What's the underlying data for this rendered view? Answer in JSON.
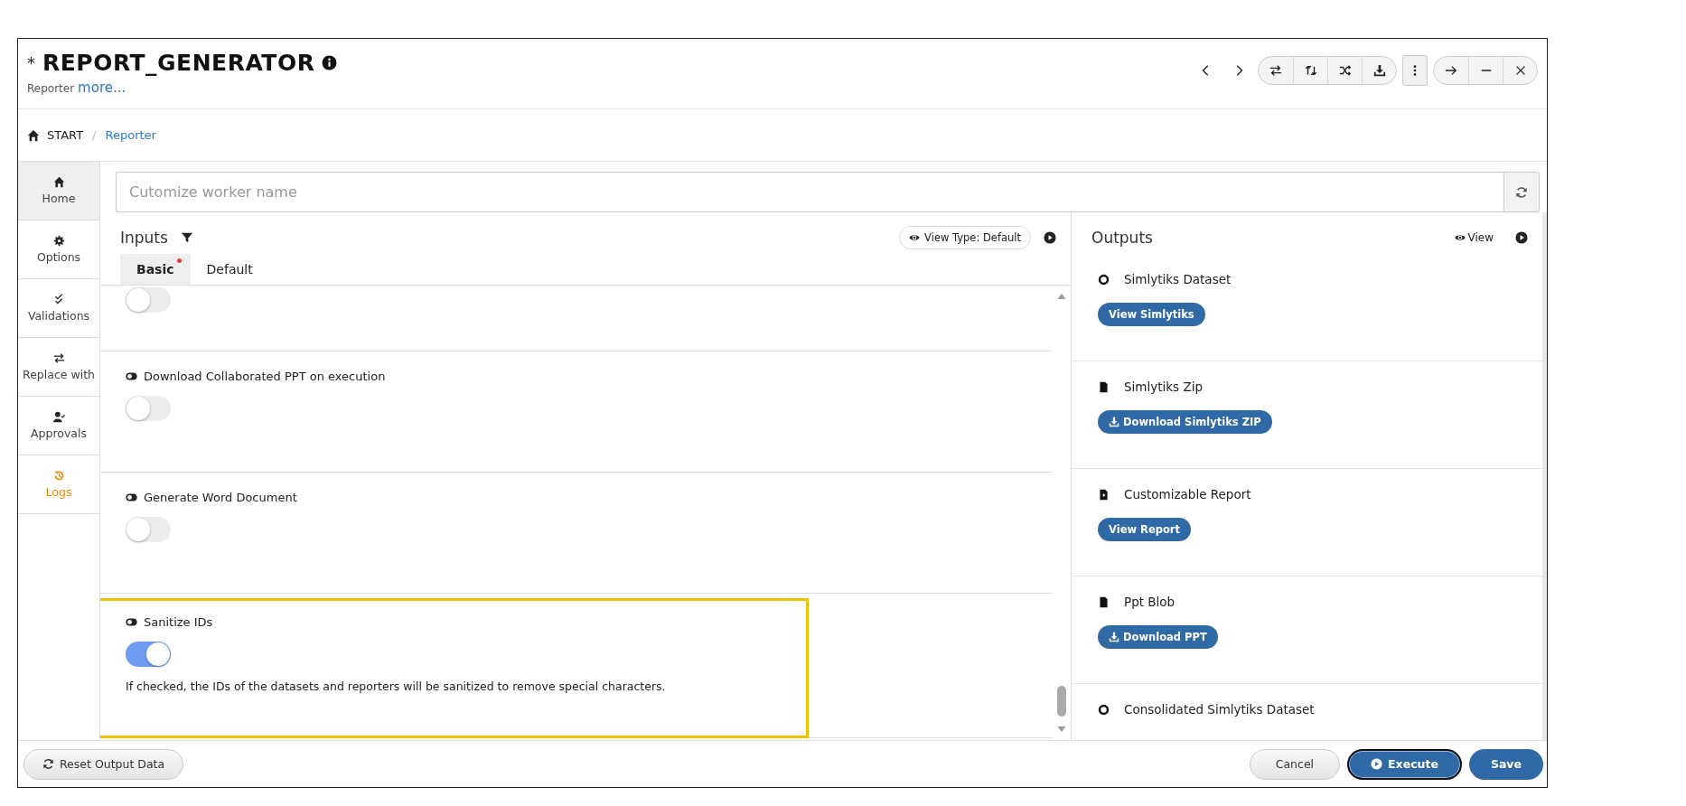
{
  "window": {
    "modified_mark": "*",
    "title": "REPORT_GENERATOR",
    "subtitle": "Reporter",
    "more_link": "more..."
  },
  "breadcrumb": [
    {
      "label": "START",
      "kind": "home"
    },
    {
      "label": "Reporter",
      "kind": "link"
    }
  ],
  "breadcrumb_separator": "/",
  "sidebar": {
    "items": [
      {
        "label": "Home",
        "selected": true,
        "attention": false
      },
      {
        "label": "Options",
        "selected": false,
        "attention": false
      },
      {
        "label": "Validations",
        "selected": false,
        "attention": false
      },
      {
        "label": "Replace with",
        "selected": false,
        "attention": false
      },
      {
        "label": "Approvals",
        "selected": false,
        "attention": false
      },
      {
        "label": "Logs",
        "selected": false,
        "attention": true
      }
    ]
  },
  "worker_name": {
    "placeholder": "Cutomize worker name"
  },
  "inputs": {
    "title": "Inputs",
    "view_type": "View Type: Default",
    "tabs": [
      {
        "label": "Basic",
        "selected": true,
        "required": true
      },
      {
        "label": "Default",
        "selected": false,
        "required": false
      }
    ],
    "fields": [
      {
        "on": false,
        "highlighted": false
      },
      {
        "label": "Download Collaborated PPT on execution",
        "on": false,
        "highlighted": false
      },
      {
        "label": "Generate Word Document",
        "on": false,
        "highlighted": false
      },
      {
        "label": "Sanitize IDs",
        "on": true,
        "highlighted": true,
        "description": "If checked, the IDs of the datasets and reporters will be sanitized to remove special characters."
      }
    ]
  },
  "outputs": {
    "title": "Outputs",
    "view": "View",
    "items": [
      {
        "label": "Simlytiks Dataset",
        "kind": "dataset",
        "button": {
          "label": "View Simlytiks",
          "kind": "view"
        }
      },
      {
        "label": "Simlytiks Zip",
        "kind": "file",
        "button": {
          "label": "Download Simlytiks ZIP",
          "kind": "download"
        }
      },
      {
        "label": "Customizable Report",
        "kind": "report",
        "button": {
          "label": "View Report",
          "kind": "view"
        }
      },
      {
        "label": "Ppt Blob",
        "kind": "file",
        "button": {
          "label": "Download PPT",
          "kind": "download"
        }
      },
      {
        "label": "Consolidated Simlytiks Dataset",
        "kind": "dataset"
      }
    ]
  },
  "footer": {
    "reset": "Reset Output Data",
    "cancel": "Cancel",
    "execute": "Execute",
    "save": "Save"
  }
}
